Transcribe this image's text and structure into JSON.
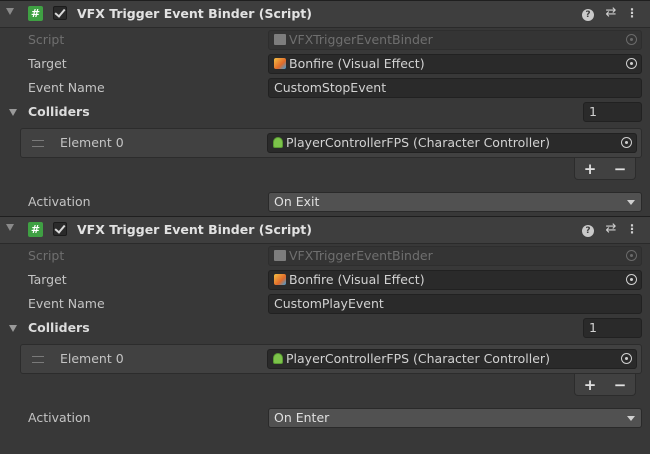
{
  "components": [
    {
      "title": "VFX Trigger Event Binder (Script)",
      "script_label": "Script",
      "script_value": "VFXTriggerEventBinder",
      "target_label": "Target",
      "target_value": "Bonfire (Visual Effect)",
      "event_label": "Event Name",
      "event_value": "CustomStopEvent",
      "colliders_label": "Colliders",
      "colliders_count": "1",
      "element_label": "Element 0",
      "element_value": "PlayerControllerFPS (Character Controller)",
      "plus": "+",
      "minus": "−",
      "activation_label": "Activation",
      "activation_value": "On Exit"
    },
    {
      "title": "VFX Trigger Event Binder (Script)",
      "script_label": "Script",
      "script_value": "VFXTriggerEventBinder",
      "target_label": "Target",
      "target_value": "Bonfire (Visual Effect)",
      "event_label": "Event Name",
      "event_value": "CustomPlayEvent",
      "colliders_label": "Colliders",
      "colliders_count": "1",
      "element_label": "Element 0",
      "element_value": "PlayerControllerFPS (Character Controller)",
      "plus": "+",
      "minus": "−",
      "activation_label": "Activation",
      "activation_value": "On Enter"
    }
  ],
  "header_icons": {
    "script_glyph": "#",
    "help": "?",
    "preset": "⇄",
    "more": "⋮"
  },
  "icons": [
    "foldout-arrow-icon",
    "script-icon",
    "checkbox-icon",
    "help-icon",
    "preset-icon",
    "more-options-icon",
    "object-picker-icon",
    "visual-effect-icon",
    "character-controller-icon",
    "drag-handle-icon",
    "dropdown-caret-icon"
  ],
  "colors": {
    "background": "#383838",
    "header": "#3e3e3e",
    "field": "#2a2a2a",
    "script_icon": "#3fa043"
  }
}
